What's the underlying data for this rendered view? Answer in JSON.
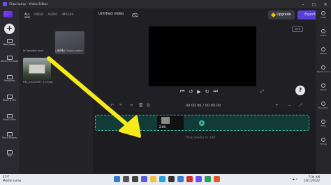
{
  "window": {
    "title": "Clipchamp - Video Editor"
  },
  "rail": {
    "items": [
      {
        "label": "Your media"
      },
      {
        "label": "Record & create"
      },
      {
        "label": "Templates"
      },
      {
        "label": "Music & SFX"
      },
      {
        "label": "Stock video"
      },
      {
        "label": "Stock images"
      },
      {
        "label": "Text"
      }
    ]
  },
  "media": {
    "tabs": [
      "ALL",
      "VIDEO",
      "AUDIO",
      "IMAGES"
    ],
    "files": [
      {
        "name": "InCampfire.mp4"
      },
      {
        "name": "Untitled Project.webm",
        "duration": "2:21"
      },
      {
        "name": "PXL_20220927_114.jpg"
      }
    ]
  },
  "header": {
    "video_title": "Untitled video",
    "upgrade_label": "Upgrade",
    "export_label": "Export"
  },
  "preview": {
    "aspect_ratio": "16:9"
  },
  "timeline": {
    "timecode": "00:00.00 / 00:00.00",
    "clip_duration": "2:00",
    "drop_message": "Drop media to add"
  },
  "right_panel": {
    "items": [
      {
        "label": "Audio"
      },
      {
        "label": "Filters"
      },
      {
        "label": "Effects"
      },
      {
        "label": "Adjust colors"
      },
      {
        "label": "Speed"
      },
      {
        "label": "Transition"
      },
      {
        "label": "Fade"
      },
      {
        "label": "Timing"
      }
    ]
  },
  "taskbar": {
    "weather_temp": "57°F",
    "weather_desc": "Mostly sunny",
    "time": "7:34 AM",
    "date": "10/11/2022"
  },
  "colors": {
    "accent": "#5a3fd6",
    "drop_border": "#3bbfa8",
    "arrow": "#f6ea1a"
  }
}
